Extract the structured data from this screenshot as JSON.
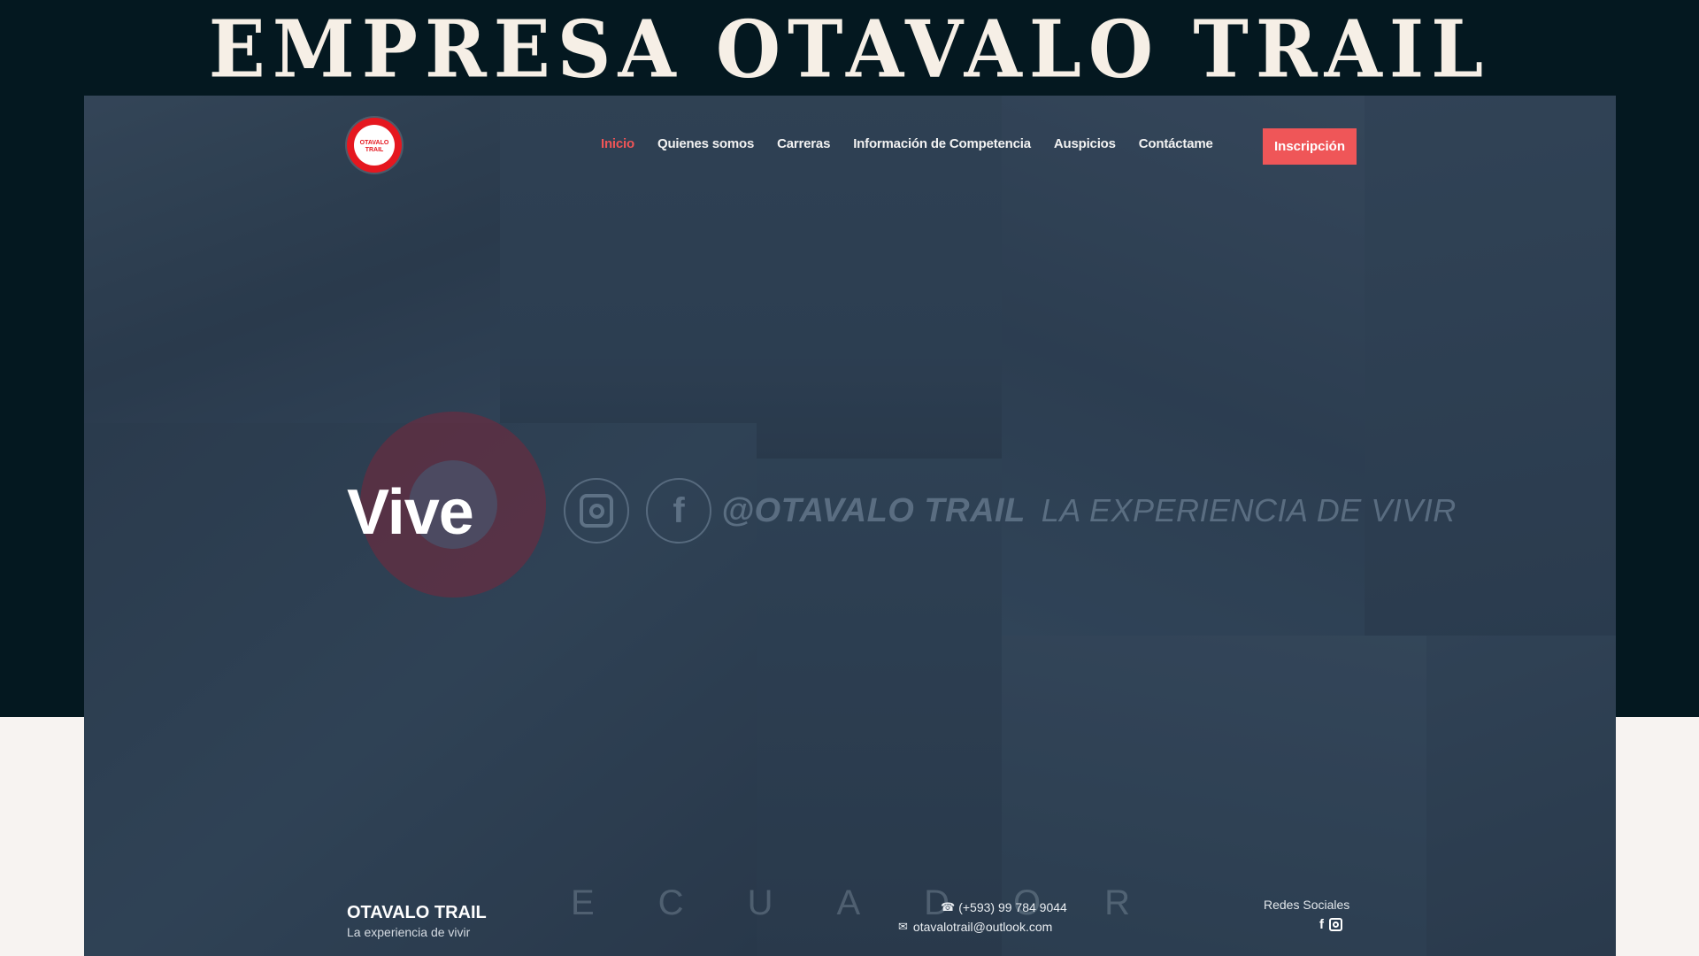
{
  "banner": {
    "title": "EMPRESA OTAVALO TRAIL"
  },
  "site": {
    "logo_text": "OTAVALO TRAIL",
    "nav": [
      {
        "label": "Inicio",
        "active": true
      },
      {
        "label": "Quienes somos"
      },
      {
        "label": "Carreras"
      },
      {
        "label": "Información de Competencia"
      },
      {
        "label": "Auspicios"
      },
      {
        "label": "Contáctame"
      }
    ],
    "cta_label": "Inscripción",
    "accent_color": "#ef5658",
    "logo_color": "#e5171f"
  },
  "hero": {
    "title": "Vive",
    "tagline_handle": "@OTAVALO TRAIL",
    "tagline_text": "LA EXPERIENCIA DE VIVIR",
    "social_icons": [
      "instagram-icon",
      "facebook-icon"
    ]
  },
  "footer": {
    "brand": "OTAVALO TRAIL",
    "slogan": "La experiencia de vivir",
    "watermark": "ECUADOR",
    "phone": "(+593) 99 784 9044",
    "email": "otavalotrail@outlook.com",
    "social_heading": "Redes Sociales",
    "social_icons": [
      "facebook-icon",
      "instagram-icon"
    ]
  }
}
